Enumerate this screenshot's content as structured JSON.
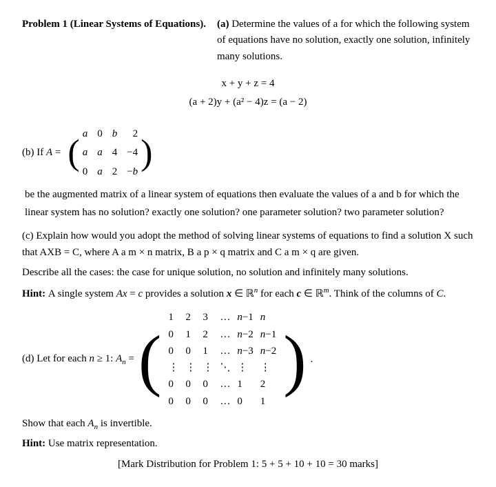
{
  "problem": {
    "label": "Problem 1",
    "subtitle": "(Linear Systems of Equations).",
    "part_a_label": "(a)",
    "part_a_text": "Determine the values of a for which the following system of equations have no solution, exactly one solution, infinitely many solutions.",
    "eq1": "x + y + z = 4",
    "eq2": "(a + 2)y + (a² − 4)z = (a − 2)",
    "part_b_intro": "(b) If A =",
    "part_b_text": "be the augmented matrix of a linear system of equations then evaluate the values of a and b for which the linear system has no solution?  exactly one solution?  one parameter solution?  two parameter solution?",
    "matrix_b": [
      [
        "a",
        "0",
        "b",
        "2"
      ],
      [
        "a",
        "a",
        "4",
        "−4"
      ],
      [
        "0",
        "a",
        "2",
        "−b"
      ]
    ],
    "part_c_label": "(c)",
    "part_c_text1": "Explain how would you adopt the method of solving linear systems of equations to find a solution X such that AXB = C, where A a m × n matrix, B a p × q matrix and C a m × q are given.",
    "part_c_text2": "Describe all the cases: the case for unique solution, no solution and infinitely many solutions.",
    "hint_label": "Hint:",
    "hint_text": "A single system Ax = c provides a solution x ∈ ℝⁿ for each c ∈ ℝᵐ. Think of the columns of C.",
    "part_d_label": "(d)",
    "part_d_text": "Let for each n ≥ 1: A",
    "part_d_subscript": "n",
    "part_d_equals": "=",
    "matrix_d": [
      [
        "1",
        "2",
        "3",
        "...",
        "n−1",
        "n"
      ],
      [
        "0",
        "1",
        "2",
        "...",
        "n−2",
        "n−1"
      ],
      [
        "0",
        "0",
        "1",
        "...",
        "n−3",
        "n−2"
      ],
      [
        ":",
        ":",
        ":",
        "⋱",
        ":",
        ":"
      ],
      [
        "0",
        "0",
        "0",
        "...",
        "1",
        "2"
      ],
      [
        "0",
        "0",
        "0",
        "...",
        "0",
        "1"
      ]
    ],
    "show_invertible": "Show that each A",
    "show_invertible_sub": "n",
    "show_invertible_end": " is invertible.",
    "hint2_label": "Hint:",
    "hint2_text": "Use matrix representation.",
    "mark_dist": "[Mark Distribution for Problem 1: 5 + 5 + 10 + 10 = 30 marks]"
  }
}
